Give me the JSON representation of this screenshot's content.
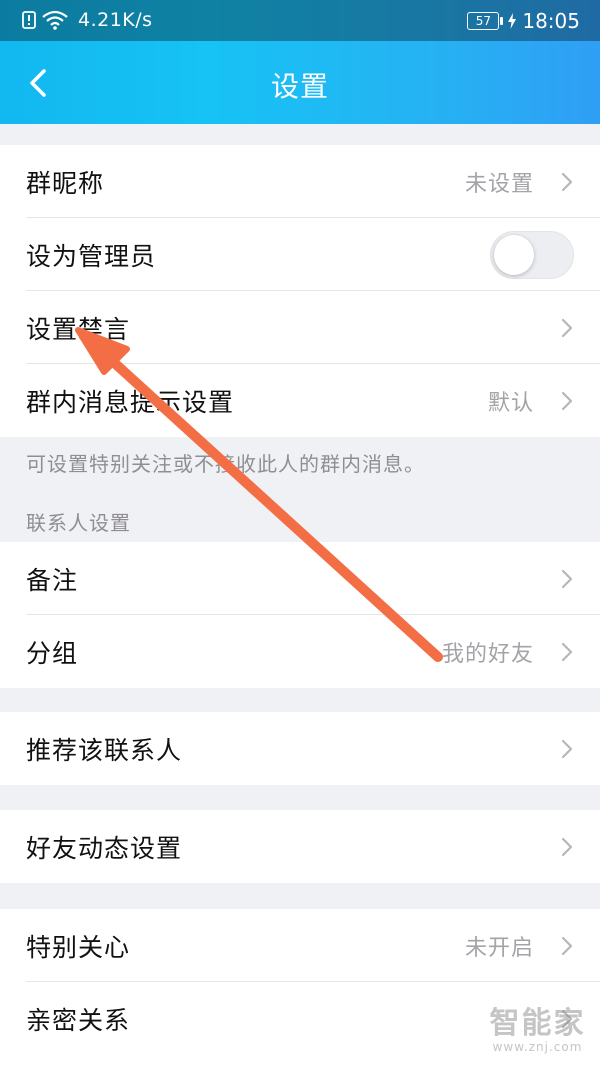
{
  "status_bar": {
    "net_speed": "4.21K/s",
    "battery": "57",
    "time": "18:05"
  },
  "nav": {
    "title": "设置",
    "back_icon": "chevron-left-icon"
  },
  "colors": {
    "header_gradient_start": "#12b8f0",
    "header_gradient_end": "#2f9ff4",
    "annotation_arrow": "#f36e45"
  },
  "group1": {
    "nickname": {
      "label": "群昵称",
      "value": "未设置"
    },
    "admin": {
      "label": "设为管理员",
      "toggle_on": false
    },
    "mute": {
      "label": "设置禁言"
    },
    "msg_notify": {
      "label": "群内消息提示设置",
      "value": "默认"
    }
  },
  "group1_hint": "可设置特别关注或不接收此人的群内消息。",
  "contact_section_title": "联系人设置",
  "contact": {
    "remark": {
      "label": "备注"
    },
    "group": {
      "label": "分组",
      "value": "我的好友"
    }
  },
  "recommend": {
    "label": "推荐该联系人"
  },
  "moments": {
    "label": "好友动态设置"
  },
  "care": {
    "special": {
      "label": "特别关心",
      "value": "未开启"
    },
    "intimate": {
      "label": "亲密关系"
    }
  },
  "watermark": {
    "main": "智能家",
    "sub": "www.znj.com"
  }
}
